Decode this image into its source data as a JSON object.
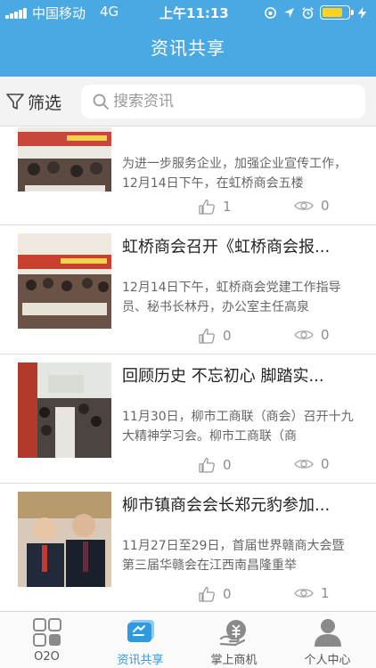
{
  "status_bar": {
    "carrier": "中国移动",
    "network": "4G",
    "time": "上午11:13"
  },
  "header": {
    "title": "资讯共享"
  },
  "filter": {
    "label": "筛选"
  },
  "search": {
    "placeholder": "搜索资讯"
  },
  "news": [
    {
      "title": "",
      "summary": "为进一步服务企业，加强企业宣传工作，12月14日下午，在虹桥商会五楼",
      "likes": "1",
      "views": "0"
    },
    {
      "title": "虹桥商会召开《虹桥商会报...",
      "summary": "12月14日下午，虹桥商会党建工作指导员、秘书长林丹，办公室主任高泉",
      "likes": "0",
      "views": "0"
    },
    {
      "title": "回顾历史  不忘初心 脚踏实...",
      "summary": "11月30日，柳市工商联（商会）召开十九大精神学习会。柳市工商联（商",
      "likes": "0",
      "views": "0"
    },
    {
      "title": "柳市镇商会会长郑元豹参加...",
      "summary": "11月27日至29日，首届世界赣商大会暨第三届华赣会在江西南昌隆重举",
      "likes": "0",
      "views": "1"
    }
  ],
  "tabs": [
    {
      "label": "O2O",
      "icon": "grid-icon"
    },
    {
      "label": "资讯共享",
      "icon": "news-share-icon",
      "active": true
    },
    {
      "label": "掌上商机",
      "icon": "business-hand-icon"
    },
    {
      "label": "个人中心",
      "icon": "person-icon"
    }
  ],
  "colors": {
    "header_bg": "#4aa9e3",
    "accent": "#2e9be0",
    "battery": "#ffd21f",
    "tab_inactive": "#8a8a8a"
  }
}
